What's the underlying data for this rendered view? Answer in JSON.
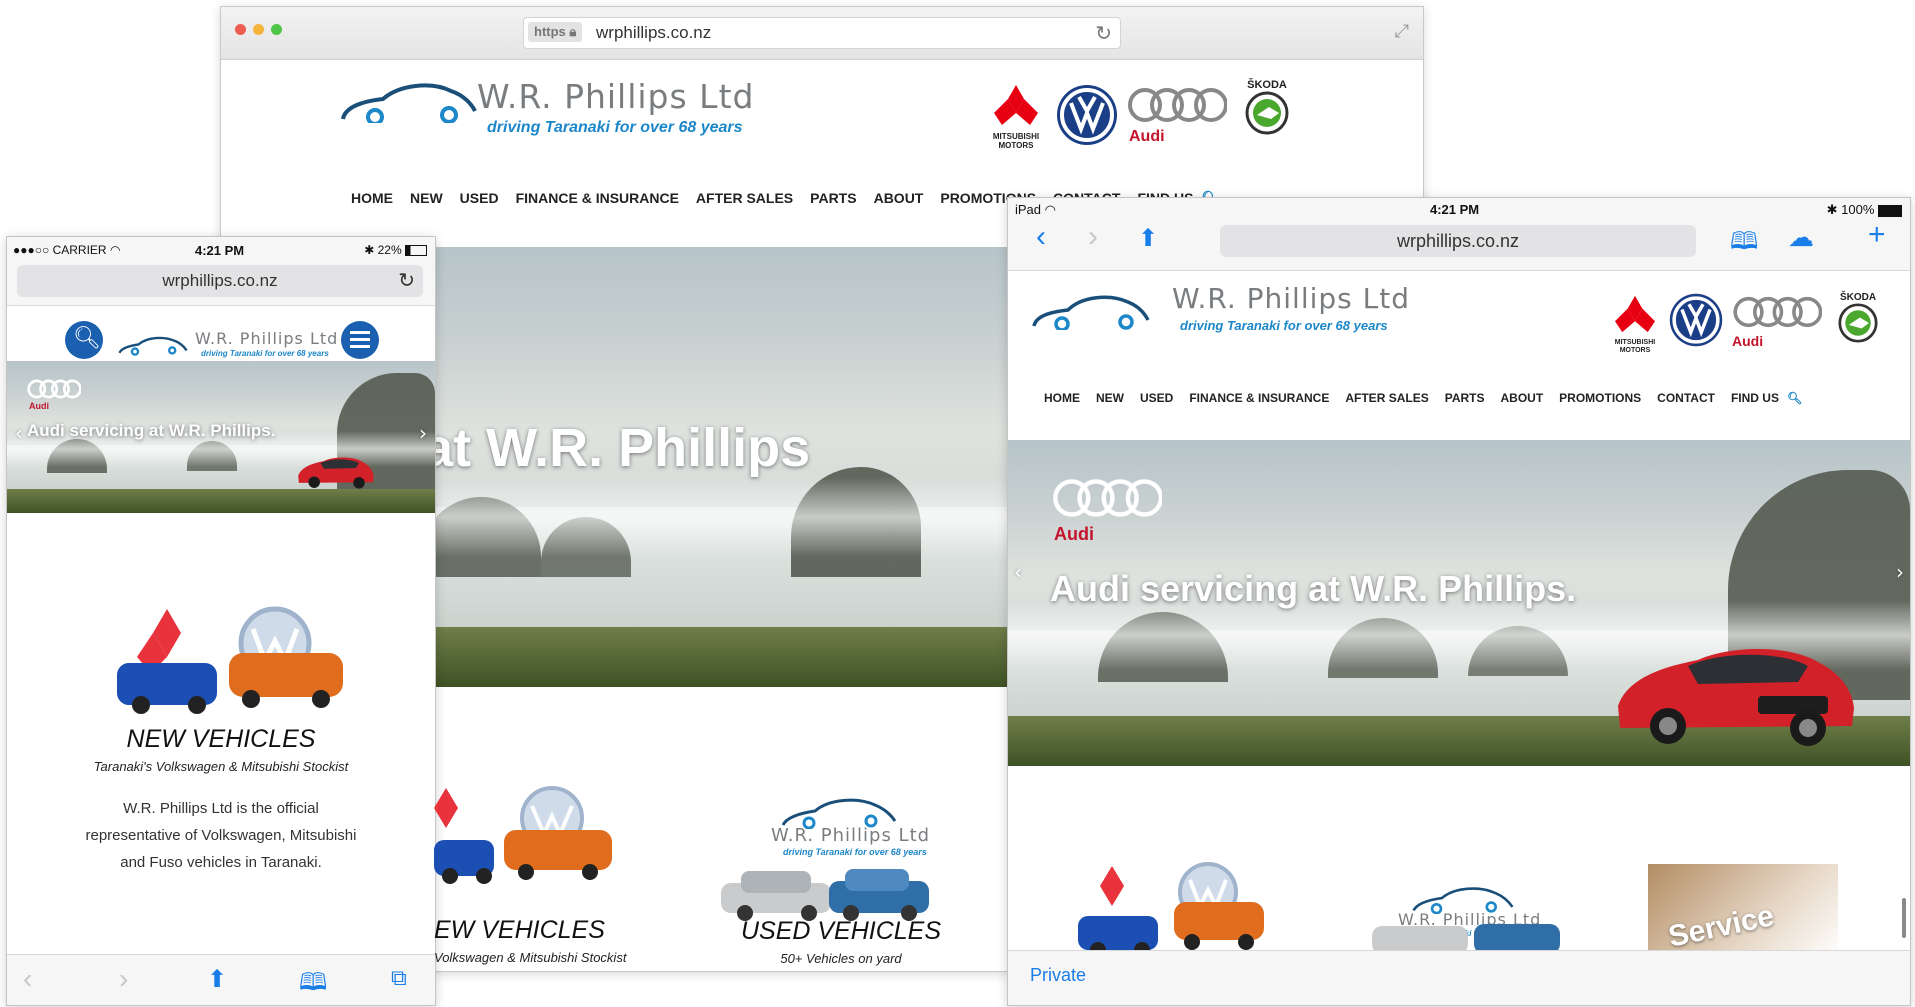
{
  "site": {
    "name": "W.R. Phillips Ltd",
    "tagline": "driving Taranaki for over 68 years",
    "url": "wrphillips.co.nz",
    "https_label": "https"
  },
  "brands": {
    "mitsubishi": [
      "MITSUBISHI",
      "MOTORS"
    ],
    "audi": "Audi",
    "skoda": "ŠKODA"
  },
  "nav": [
    "HOME",
    "NEW",
    "USED",
    "FINANCE & INSURANCE",
    "AFTER SALES",
    "PARTS",
    "ABOUT",
    "PROMOTIONS",
    "CONTACT",
    "FIND US"
  ],
  "desktop": {
    "hero_title": "servicing at W.R. Phillips"
  },
  "hero": {
    "title": "Audi servicing at W.R. Phillips.",
    "brand": "Audi"
  },
  "sections": {
    "new_title": "NEW VEHICLES",
    "new_sub": "Taranaki's Volkswagen & Mitsubishi Stockist",
    "new_title_cut": "EW VEHICLES",
    "new_sub_cut": "Volkswagen & Mitsubishi Stockist",
    "used_title": "USED VEHICLES",
    "used_sub": "50+ Vehicles on yard",
    "service_label": "Service"
  },
  "phone": {
    "carrier": "●●●○○ CARRIER",
    "time": "4:21 PM",
    "battery": "22%",
    "body_line1": "W.R. Phillips Ltd is the official",
    "body_line2": "representative of Volkswagen, Mitsubishi",
    "body_line3": "and Fuso vehicles in Taranaki."
  },
  "ipad": {
    "device": "iPad",
    "time": "4:21 PM",
    "battery": "100%",
    "private_label": "Private"
  },
  "colors": {
    "accent": "#1a7ee8",
    "brand_blue": "#1c87c9",
    "audi_red": "#c4142b"
  }
}
